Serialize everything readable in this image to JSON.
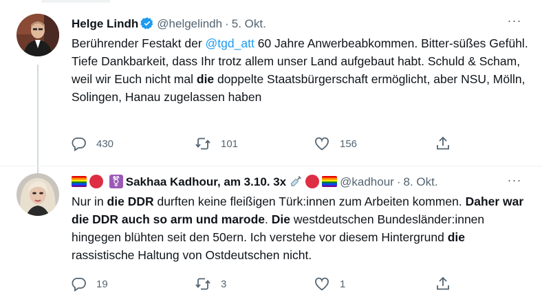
{
  "tweets": [
    {
      "author_name": "Helge Lindh",
      "handle": "@helgelindh",
      "separator": "·",
      "date": "5. Okt.",
      "more": "···",
      "text_parts": {
        "p1": "Berührender Festakt der ",
        "mention": "@tgd_att",
        "p2": " 60 Jahre Anwerbeabkommen. Bitter-süßes Gefühl. Tiefe Dankbarkeit, dass Ihr trotz allem unser Land aufgebaut habt. Schuld & Scham, weil wir Euch nicht mal ",
        "b1": "die",
        "p3": " doppelte Staatsbürgerschaft ermöglicht, aber NSU, Mölln, Solingen, Hanau zugelassen haben"
      },
      "replies": "430",
      "retweets": "101",
      "likes": "156"
    },
    {
      "author_name": "Sakhaa Kadhour, am 3.10. 3x",
      "handle": "@kadhour",
      "separator": "·",
      "date": "8. Okt.",
      "more": "···",
      "text_parts": {
        "p1": "Nur in ",
        "b1": "die DDR",
        "p2": " durften keine fleißigen Türk:innen zum Arbeiten kommen. ",
        "b2": "Daher war die DDR auch so arm und marode",
        "p3": ". ",
        "b3": "Die",
        "p4": " westdeutschen Bundesländer:innen hingegen blühten seit den 50ern. Ich verstehe vor diesem Hintergrund ",
        "b4": "die",
        "p5": " rassistische Haltung von Ostdeutschen nicht."
      },
      "replies": "19",
      "retweets": "3",
      "likes": "1"
    }
  ],
  "icons": {
    "verified": "verified-badge-icon",
    "reply": "reply-icon",
    "retweet": "retweet-icon",
    "like": "like-icon",
    "share": "share-icon",
    "more": "more-icon"
  },
  "colors": {
    "accent": "#1d9bf0",
    "text": "#0f1419",
    "secondary": "#536471"
  }
}
